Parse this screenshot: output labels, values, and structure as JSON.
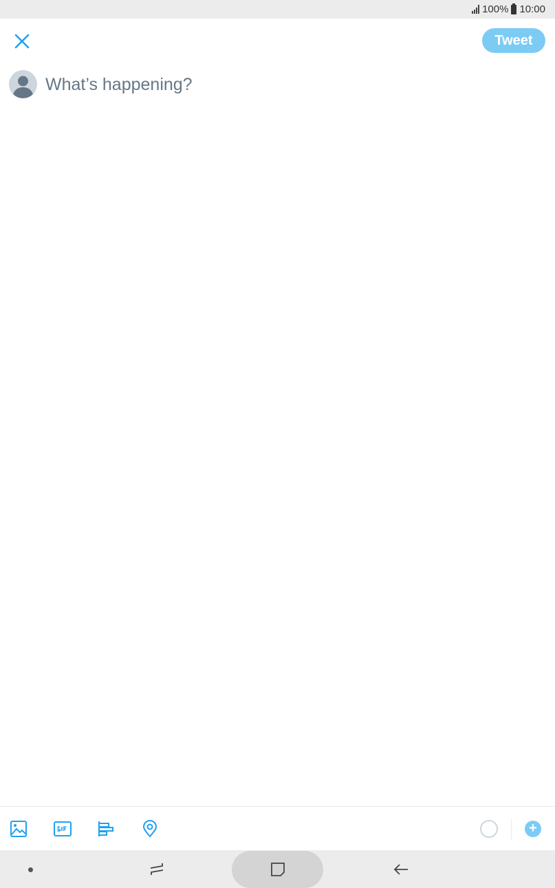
{
  "status_bar": {
    "battery": "100%",
    "time": "10:00"
  },
  "header": {
    "close_icon": "close-icon",
    "tweet_label": "Tweet"
  },
  "compose": {
    "avatar_icon": "default-avatar-icon",
    "placeholder": "What’s happening?"
  },
  "toolbar": {
    "icons": [
      "image-icon",
      "gif-icon",
      "poll-icon",
      "location-icon"
    ],
    "add_icon": "add-thread-icon"
  },
  "nav": {
    "icons": [
      "nav-dot-icon",
      "recent-apps-icon",
      "home-icon",
      "back-icon"
    ]
  },
  "colors": {
    "accent": "#1da1f2",
    "tweet_button": "#7ccbf5",
    "placeholder_text": "#657786"
  }
}
